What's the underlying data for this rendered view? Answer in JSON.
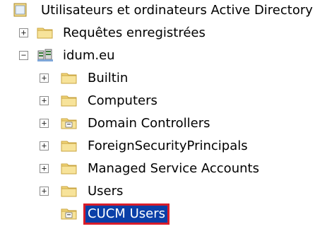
{
  "tree": {
    "root": {
      "label": "Utilisateurs et ordinateurs Active Directory",
      "icon": "ad-console-icon"
    },
    "saved_queries": {
      "label": "Requêtes enregistrées",
      "icon": "folder-icon",
      "expander": "+"
    },
    "domain": {
      "label": "idum.eu",
      "icon": "domain-icon",
      "expander": "−",
      "children": [
        {
          "label": "Builtin",
          "icon": "folder-icon",
          "expander": "+"
        },
        {
          "label": "Computers",
          "icon": "folder-icon",
          "expander": "+"
        },
        {
          "label": "Domain Controllers",
          "icon": "ou-icon",
          "expander": "+"
        },
        {
          "label": "ForeignSecurityPrincipals",
          "icon": "folder-icon",
          "expander": "+"
        },
        {
          "label": "Managed Service Accounts",
          "icon": "folder-icon",
          "expander": "+"
        },
        {
          "label": "Users",
          "icon": "folder-icon",
          "expander": "+"
        },
        {
          "label": "CUCM Users",
          "icon": "ou-icon",
          "expander": "",
          "selected": true
        }
      ]
    }
  },
  "colors": {
    "selection_bg": "#0a3fa8",
    "selection_outline": "#d81c2a",
    "folder": "#f2d67a"
  }
}
